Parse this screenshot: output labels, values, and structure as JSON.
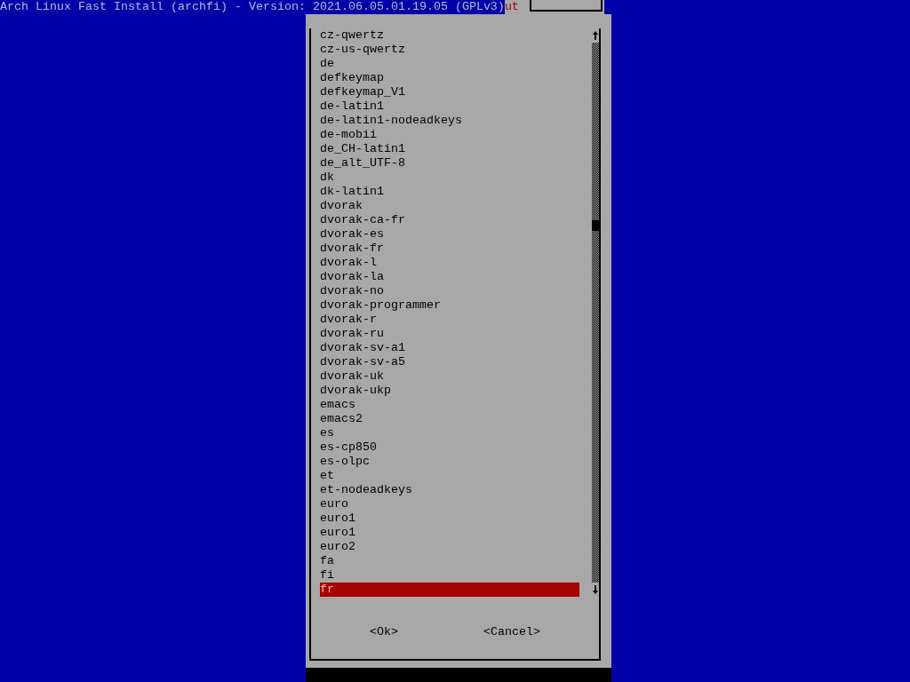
{
  "header": {
    "title": "Arch Linux Fast Install (archfi) - Version: 2021.06.05.01.19.05 (GPLv3)",
    "background_window_title": "ut"
  },
  "list": {
    "items": [
      {
        "label": "cz-qwertz",
        "selected": false
      },
      {
        "label": "cz-us-qwertz",
        "selected": false
      },
      {
        "label": "de",
        "selected": false
      },
      {
        "label": "defkeymap",
        "selected": false
      },
      {
        "label": "defkeymap_V1",
        "selected": false
      },
      {
        "label": "de-latin1",
        "selected": false
      },
      {
        "label": "de-latin1-nodeadkeys",
        "selected": false
      },
      {
        "label": "de-mobii",
        "selected": false
      },
      {
        "label": "de_CH-latin1",
        "selected": false
      },
      {
        "label": "de_alt_UTF-8",
        "selected": false
      },
      {
        "label": "dk",
        "selected": false
      },
      {
        "label": "dk-latin1",
        "selected": false
      },
      {
        "label": "dvorak",
        "selected": false
      },
      {
        "label": "dvorak-ca-fr",
        "selected": false
      },
      {
        "label": "dvorak-es",
        "selected": false
      },
      {
        "label": "dvorak-fr",
        "selected": false
      },
      {
        "label": "dvorak-l",
        "selected": false
      },
      {
        "label": "dvorak-la",
        "selected": false
      },
      {
        "label": "dvorak-no",
        "selected": false
      },
      {
        "label": "dvorak-programmer",
        "selected": false
      },
      {
        "label": "dvorak-r",
        "selected": false
      },
      {
        "label": "dvorak-ru",
        "selected": false
      },
      {
        "label": "dvorak-sv-a1",
        "selected": false
      },
      {
        "label": "dvorak-sv-a5",
        "selected": false
      },
      {
        "label": "dvorak-uk",
        "selected": false
      },
      {
        "label": "dvorak-ukp",
        "selected": false
      },
      {
        "label": "emacs",
        "selected": false
      },
      {
        "label": "emacs2",
        "selected": false
      },
      {
        "label": "es",
        "selected": false
      },
      {
        "label": "es-cp850",
        "selected": false
      },
      {
        "label": "es-olpc",
        "selected": false
      },
      {
        "label": "et",
        "selected": false
      },
      {
        "label": "et-nodeadkeys",
        "selected": false
      },
      {
        "label": "euro",
        "selected": false
      },
      {
        "label": "euro1",
        "selected": false
      },
      {
        "label": "euro1",
        "selected": false
      },
      {
        "label": "euro2",
        "selected": false
      },
      {
        "label": "fa",
        "selected": false
      },
      {
        "label": "fi",
        "selected": false
      },
      {
        "label": "fr",
        "selected": true
      }
    ]
  },
  "buttons": [
    {
      "label": "<Ok>"
    },
    {
      "label": "<Cancel>"
    }
  ]
}
